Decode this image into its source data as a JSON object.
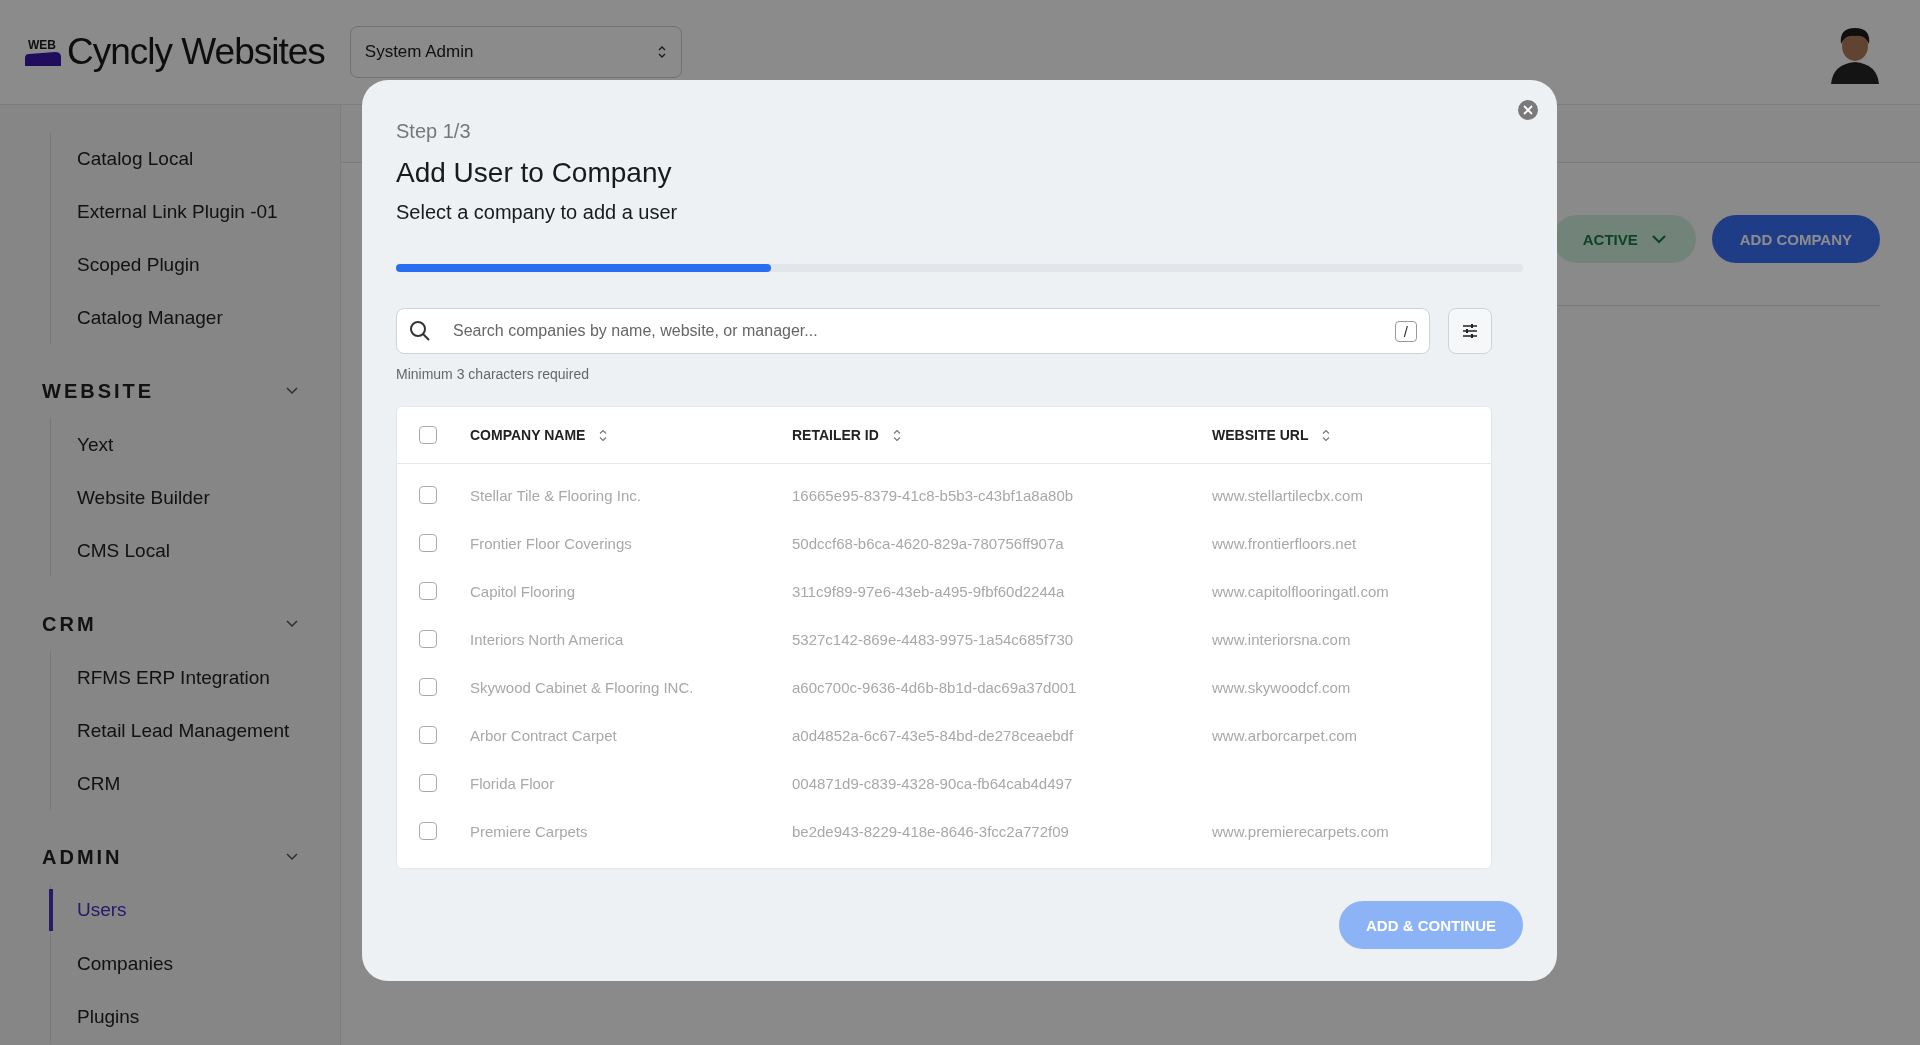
{
  "app": {
    "logo_badge": "WEB",
    "logo_text": "Cyncly Websites",
    "role_select": {
      "value": "System Admin"
    }
  },
  "sidebar": {
    "sections": [
      {
        "items": [
          {
            "label": "Catalog Local",
            "selected": false
          },
          {
            "label": "External Link Plugin -01",
            "selected": false
          },
          {
            "label": "Scoped Plugin",
            "selected": false
          },
          {
            "label": "Catalog Manager",
            "selected": false
          }
        ]
      },
      {
        "title": "WEBSITE",
        "items": [
          {
            "label": "Yext",
            "selected": false
          },
          {
            "label": "Website Builder",
            "selected": false
          },
          {
            "label": "CMS Local",
            "selected": false
          }
        ]
      },
      {
        "title": "CRM",
        "items": [
          {
            "label": "RFMS ERP Integration",
            "selected": false
          },
          {
            "label": "Retail Lead Management",
            "selected": false
          },
          {
            "label": "CRM",
            "selected": false
          }
        ]
      },
      {
        "title": "ADMIN",
        "items": [
          {
            "label": "Users",
            "selected": true
          },
          {
            "label": "Companies",
            "selected": false
          },
          {
            "label": "Plugins",
            "selected": false
          }
        ]
      }
    ]
  },
  "page": {
    "status_filter": "ACTIVE",
    "add_button": "ADD COMPANY"
  },
  "modal": {
    "step": "Step 1/3",
    "title": "Add User to Company",
    "subtitle": "Select a company to add a user",
    "progress": {
      "level": 0.333
    },
    "search": {
      "placeholder": "Search companies by name, website, or manager...",
      "shortcut": "/"
    },
    "hint": "Minimum 3 characters required",
    "table": {
      "select_all_checked": false,
      "columns": [
        {
          "label": "COMPANY NAME"
        },
        {
          "label": "RETAILER ID"
        },
        {
          "label": "WEBSITE URL"
        }
      ],
      "rows": [
        {
          "checked": false,
          "company_name": "Stellar Tile & Flooring Inc.",
          "retailer_id": "16665e95-8379-41c8-b5b3-c43bf1a8a80b",
          "website_url": "www.stellartilecbx.com"
        },
        {
          "checked": false,
          "company_name": "Frontier Floor Coverings",
          "retailer_id": "50dccf68-b6ca-4620-829a-780756ff907a",
          "website_url": "www.frontierfloors.net"
        },
        {
          "checked": false,
          "company_name": "Capitol Flooring",
          "retailer_id": "311c9f89-97e6-43eb-a495-9fbf60d2244a",
          "website_url": "www.capitolflooringatl.com"
        },
        {
          "checked": false,
          "company_name": "Interiors North America",
          "retailer_id": "5327c142-869e-4483-9975-1a54c685f730",
          "website_url": "www.interiorsna.com"
        },
        {
          "checked": false,
          "company_name": "Skywood Cabinet & Flooring INC.",
          "retailer_id": "a60c700c-9636-4d6b-8b1d-dac69a37d001",
          "website_url": "www.skywoodcf.com"
        },
        {
          "checked": false,
          "company_name": "Arbor Contract Carpet",
          "retailer_id": "a0d4852a-6c67-43e5-84bd-de278ceaebdf",
          "website_url": "www.arborcarpet.com"
        },
        {
          "checked": false,
          "company_name": "Florida Floor",
          "retailer_id": "004871d9-c839-4328-90ca-fb64cab4d497"
        },
        {
          "checked": false,
          "company_name": "Premiere Carpets",
          "retailer_id": "be2de943-8229-418e-8646-3fcc2a772f09",
          "website_url": "www.premierecarpets.com"
        }
      ]
    },
    "primary_button": {
      "label": "ADD & CONTINUE",
      "disabled": true
    }
  }
}
